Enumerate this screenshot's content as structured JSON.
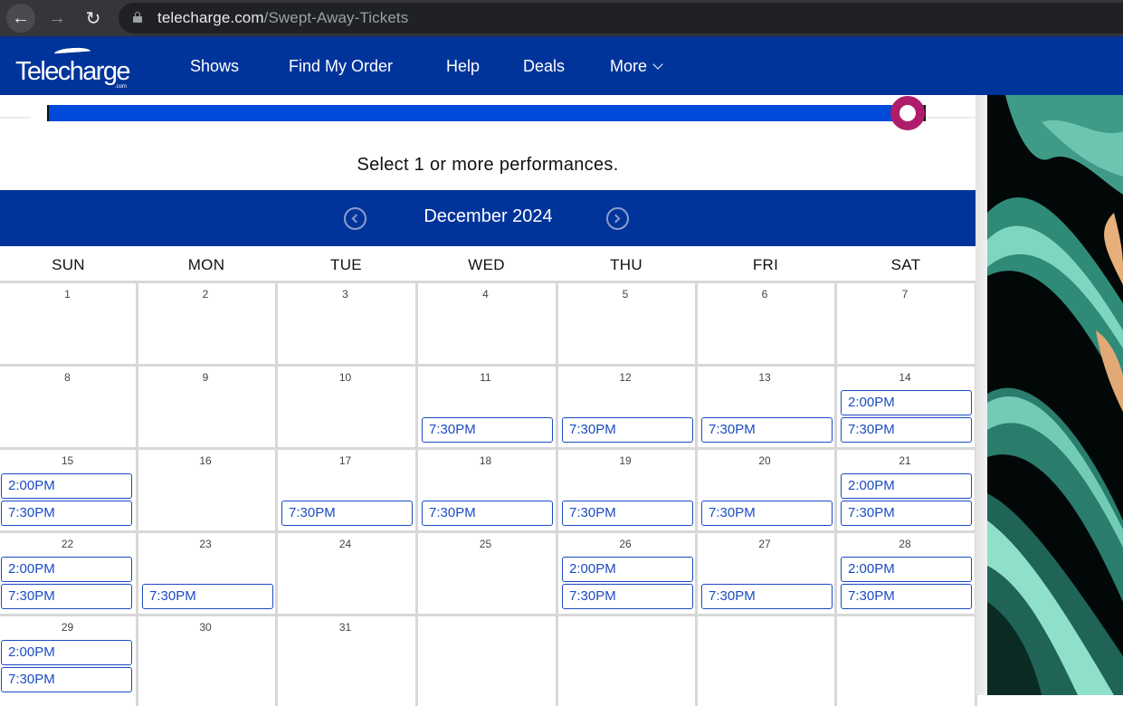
{
  "browser": {
    "url_host": "telecharge.com",
    "url_path": "/Swept-Away-Tickets",
    "back_icon": "←",
    "forward_icon": "→",
    "reload_icon": "↻"
  },
  "header": {
    "logo_text": "Telecharge",
    "logo_suffix": ".com",
    "nav": [
      {
        "label": "Shows"
      },
      {
        "label": "Find My Order"
      },
      {
        "label": "Help"
      },
      {
        "label": "Deals"
      },
      {
        "label": "More"
      }
    ],
    "brand_color": "#01349b"
  },
  "progress": {
    "fraction": 1.0,
    "track_color": "#0149d9",
    "knob_color": "#ae1d6c"
  },
  "instructions": "Select 1 or more performances.",
  "calendar": {
    "month_label": "December 2024",
    "prev_icon": "chevron-left-circle",
    "next_icon": "chevron-right-circle",
    "weekdays": [
      "SUN",
      "MON",
      "TUE",
      "WED",
      "THU",
      "FRI",
      "SAT"
    ],
    "weeks": [
      [
        {
          "day": "1",
          "times": []
        },
        {
          "day": "2",
          "times": []
        },
        {
          "day": "3",
          "times": []
        },
        {
          "day": "4",
          "times": []
        },
        {
          "day": "5",
          "times": []
        },
        {
          "day": "6",
          "times": []
        },
        {
          "day": "7",
          "times": []
        }
      ],
      [
        {
          "day": "8",
          "times": []
        },
        {
          "day": "9",
          "times": []
        },
        {
          "day": "10",
          "times": []
        },
        {
          "day": "11",
          "times": [
            "7:30PM"
          ]
        },
        {
          "day": "12",
          "times": [
            "7:30PM"
          ]
        },
        {
          "day": "13",
          "times": [
            "7:30PM"
          ]
        },
        {
          "day": "14",
          "times": [
            "2:00PM",
            "7:30PM"
          ]
        }
      ],
      [
        {
          "day": "15",
          "times": [
            "2:00PM",
            "7:30PM"
          ]
        },
        {
          "day": "16",
          "times": []
        },
        {
          "day": "17",
          "times": [
            "7:30PM"
          ]
        },
        {
          "day": "18",
          "times": [
            "7:30PM"
          ]
        },
        {
          "day": "19",
          "times": [
            "7:30PM"
          ]
        },
        {
          "day": "20",
          "times": [
            "7:30PM"
          ]
        },
        {
          "day": "21",
          "times": [
            "2:00PM",
            "7:30PM"
          ]
        }
      ],
      [
        {
          "day": "22",
          "times": [
            "2:00PM",
            "7:30PM"
          ]
        },
        {
          "day": "23",
          "times": [
            "7:30PM"
          ]
        },
        {
          "day": "24",
          "times": []
        },
        {
          "day": "25",
          "times": []
        },
        {
          "day": "26",
          "times": [
            "2:00PM",
            "7:30PM"
          ]
        },
        {
          "day": "27",
          "times": [
            "7:30PM"
          ]
        },
        {
          "day": "28",
          "times": [
            "2:00PM",
            "7:30PM"
          ]
        }
      ],
      [
        {
          "day": "29",
          "times": [
            "2:00PM",
            "7:30PM"
          ]
        },
        {
          "day": "30",
          "times": []
        },
        {
          "day": "31",
          "times": []
        },
        {
          "day": "",
          "times": []
        },
        {
          "day": "",
          "times": []
        },
        {
          "day": "",
          "times": []
        },
        {
          "day": "",
          "times": []
        }
      ]
    ]
  },
  "side_art": {
    "description": "Swept Away show artwork - teal waves illustration"
  }
}
